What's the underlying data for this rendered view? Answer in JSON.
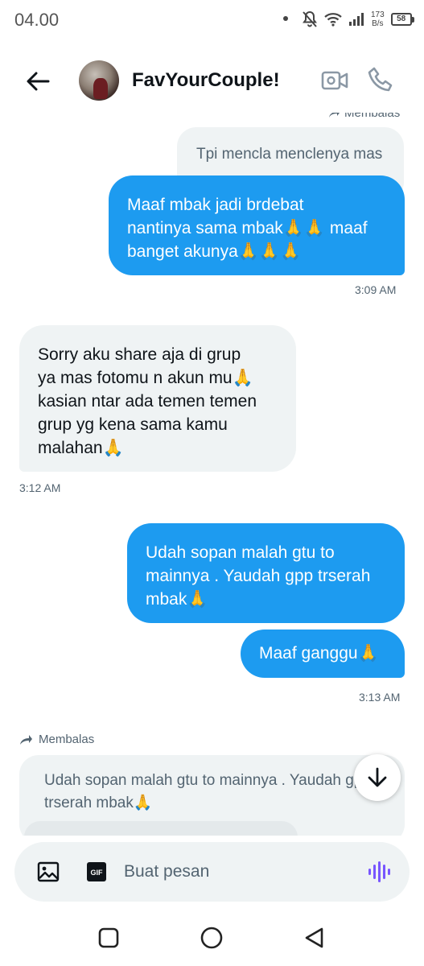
{
  "status_bar": {
    "time": "04.00",
    "speed_top": "173",
    "speed_bottom": "B/s",
    "battery": "58"
  },
  "header": {
    "contact_name": "FavYourCouple!",
    "icons": [
      "back-arrow-icon",
      "video-call-icon",
      "phone-call-icon"
    ]
  },
  "chat": {
    "top_reply_label": "Membalas",
    "quote_top": "Tpi mencla menclenya mas",
    "msg1": "Maaf mbak jadi brdebat\nnantinya sama mbak🙏🙏 maaf\nbanget akunya🙏🙏🙏",
    "time1": "3:09 AM",
    "msg2": "Sorry aku share aja di grup\nya mas fotomu n akun mu🙏\nkasian ntar ada temen temen\ngrup yg kena sama kamu\nmalahan🙏",
    "time2": "3:12 AM",
    "msg3": "Udah sopan malah gtu to\nmainnya . Yaudah gpp trserah\nmbak🙏",
    "msg4": "Maaf ganggu🙏",
    "time3": "3:13 AM",
    "reply_label": "Membalas",
    "quote_bottom": "Udah sopan malah gtu to mainnya . Yaudah gpp\ntrserah mbak🙏"
  },
  "composer": {
    "placeholder": "Buat pesan",
    "gif_label": "GIF"
  },
  "colors": {
    "accent": "#1d9bf0",
    "bubble_in": "#eff3f4",
    "muted_text": "#536471",
    "voice": "#7856ff"
  }
}
